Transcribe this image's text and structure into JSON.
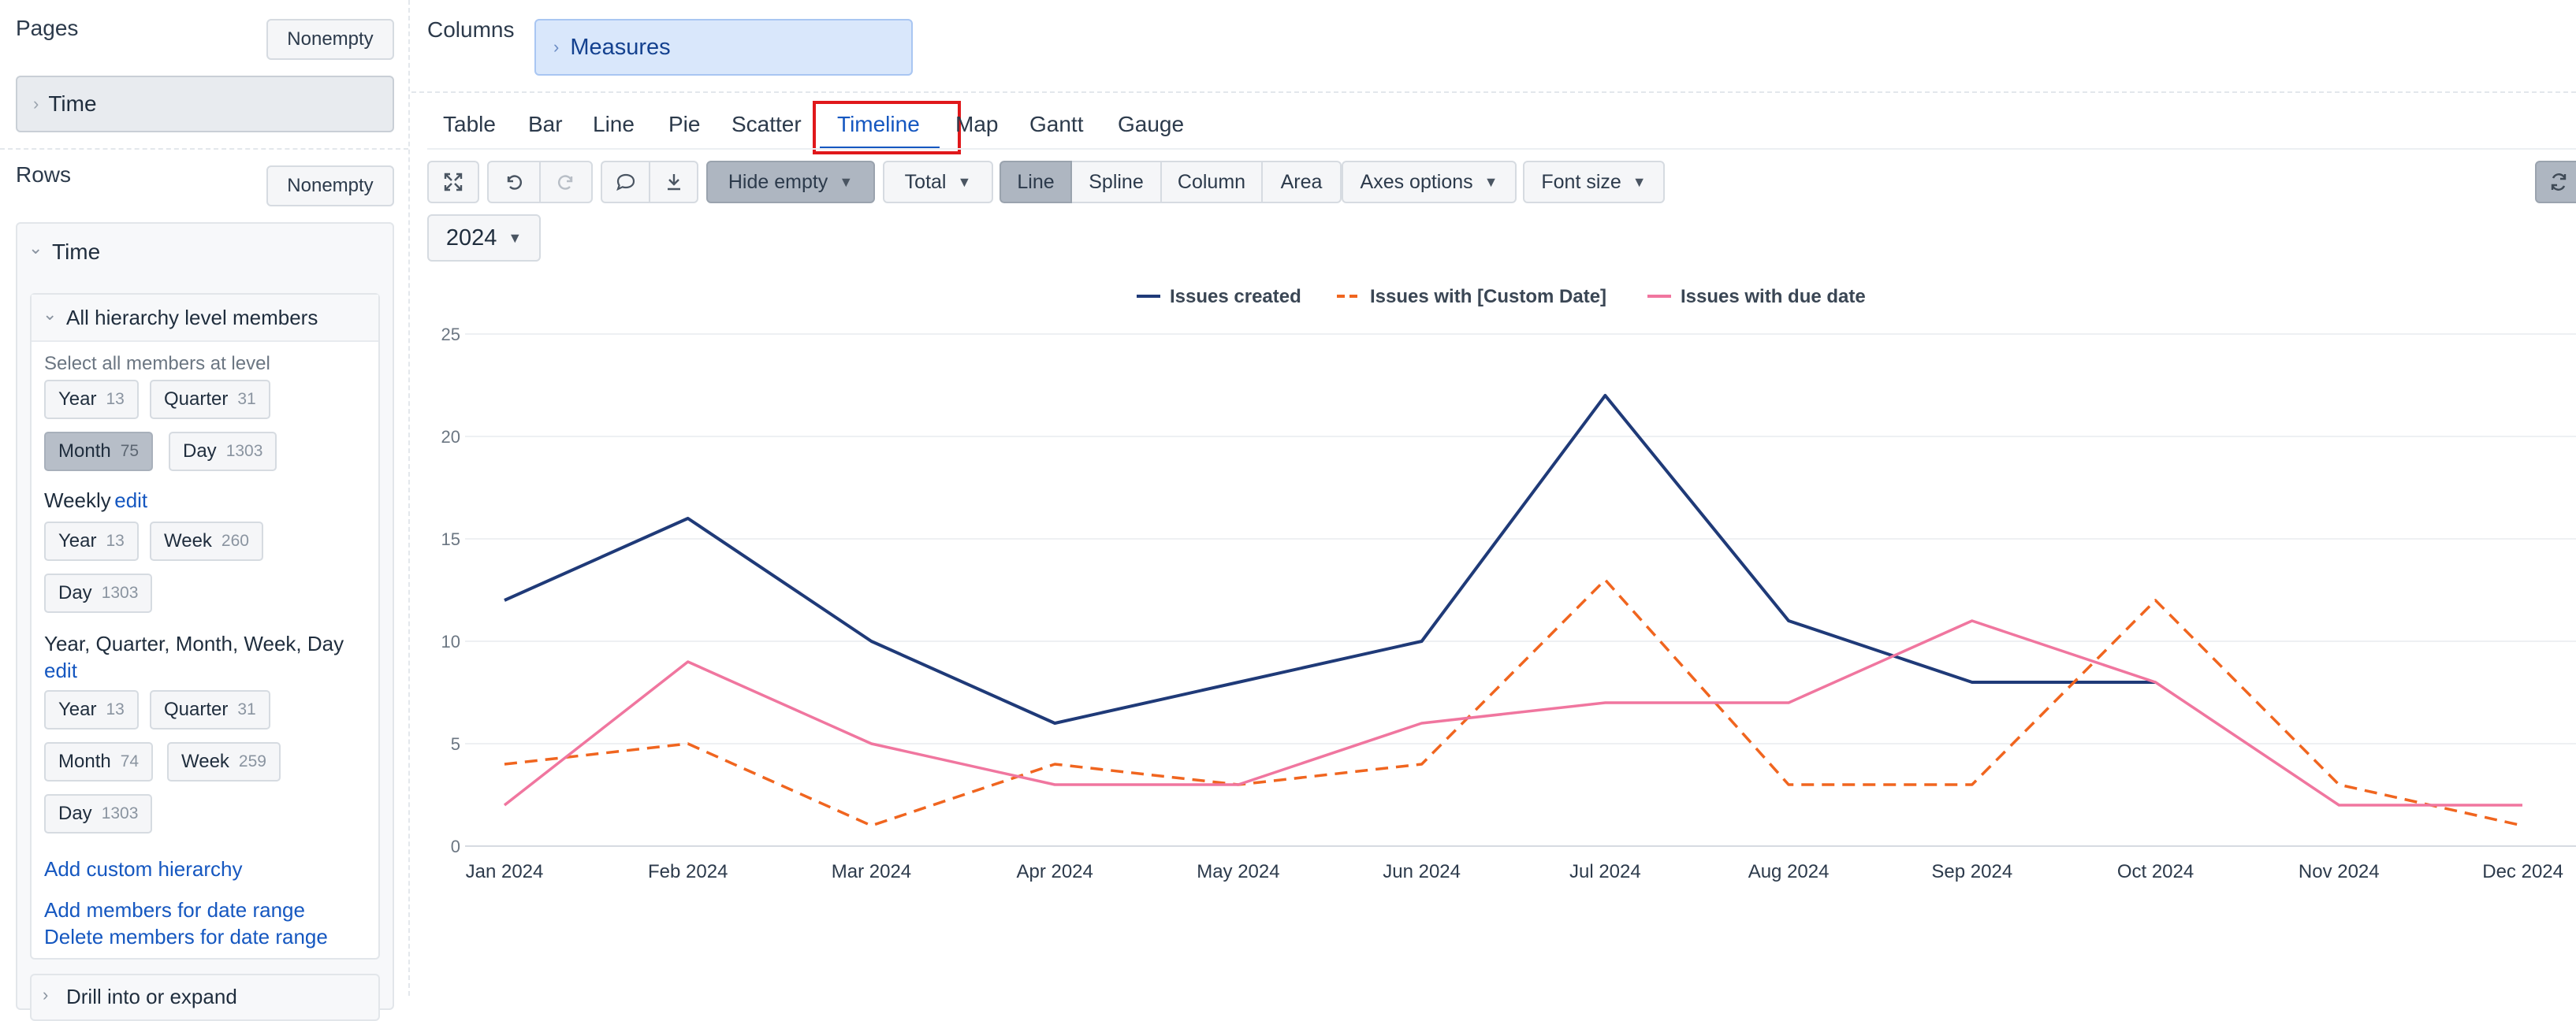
{
  "left": {
    "pages": {
      "label": "Pages",
      "nonempty_label": "Nonempty",
      "dimension": "Time"
    },
    "rows": {
      "label": "Rows",
      "nonempty_label": "Nonempty",
      "dimension": "Time"
    },
    "hierarchy_card": {
      "title": "All hierarchy level members",
      "select_all_text": "Select all members at level",
      "default_levels": [
        {
          "name": "Year",
          "count": "13"
        },
        {
          "name": "Quarter",
          "count": "31"
        },
        {
          "name": "Month",
          "count": "75",
          "selected": true
        },
        {
          "name": "Day",
          "count": "1303"
        }
      ],
      "weekly": {
        "title": "Weekly",
        "edit": "edit",
        "levels": [
          {
            "name": "Year",
            "count": "13"
          },
          {
            "name": "Week",
            "count": "260"
          },
          {
            "name": "Day",
            "count": "1303"
          }
        ]
      },
      "custom": {
        "title": "Year, Quarter, Month, Week, Day",
        "edit": "edit",
        "levels": [
          {
            "name": "Year",
            "count": "13"
          },
          {
            "name": "Quarter",
            "count": "31"
          },
          {
            "name": "Month",
            "count": "74"
          },
          {
            "name": "Week",
            "count": "259"
          },
          {
            "name": "Day",
            "count": "1303"
          }
        ]
      },
      "add_custom_hierarchy": "Add custom hierarchy",
      "add_members_range": "Add members for date range",
      "delete_members_range": "Delete members for date range"
    },
    "drill_label": "Drill into or expand"
  },
  "columns": {
    "label": "Columns",
    "measures": "Measures"
  },
  "tabs": [
    "Table",
    "Bar",
    "Line",
    "Pie",
    "Scatter",
    "Timeline",
    "Map",
    "Gantt",
    "Gauge"
  ],
  "active_tab": "Timeline",
  "toolbar": {
    "hide_empty": "Hide empty",
    "total": "Total",
    "chart_types": [
      "Line",
      "Spline",
      "Column",
      "Area"
    ],
    "active_chart_type": "Line",
    "axes_options": "Axes options",
    "font_size": "Font size",
    "icons": [
      "fullscreen-icon",
      "undo-icon",
      "redo-icon",
      "comment-icon",
      "download-icon",
      "refresh-icon"
    ]
  },
  "year_filter": "2024",
  "colors": {
    "issues_created": "#1f3a78",
    "custom_date": "#f0651f",
    "due_date": "#f0769f",
    "highlight": "#e0181b"
  },
  "chart_data": {
    "type": "line",
    "categories": [
      "Jan 2024",
      "Feb 2024",
      "Mar 2024",
      "Apr 2024",
      "May 2024",
      "Jun 2024",
      "Jul 2024",
      "Aug 2024",
      "Sep 2024",
      "Oct 2024",
      "Nov 2024",
      "Dec 2024"
    ],
    "ylim": [
      0,
      25
    ],
    "yticks": [
      0,
      5,
      10,
      15,
      20,
      25
    ],
    "grid": true,
    "legend_position": "top-center",
    "series": [
      {
        "name": "Issues created",
        "dash": "solid",
        "values": [
          12,
          16,
          10,
          6,
          8,
          10,
          22,
          11,
          8,
          8,
          null,
          null
        ]
      },
      {
        "name": "Issues with [Custom Date]",
        "dash": "dashed",
        "values": [
          4,
          5,
          1,
          4,
          3,
          4,
          13,
          3,
          3,
          12,
          3,
          1
        ]
      },
      {
        "name": "Issues with due date",
        "dash": "solid",
        "values": [
          2,
          9,
          5,
          3,
          3,
          6,
          7,
          7,
          11,
          8,
          2,
          2
        ]
      }
    ]
  }
}
